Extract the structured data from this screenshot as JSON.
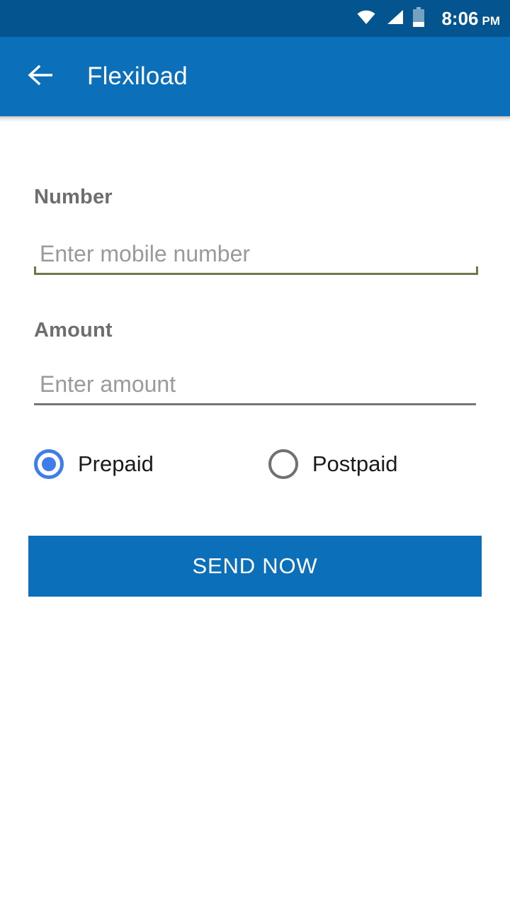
{
  "status_bar": {
    "time": "8:06",
    "ampm": "PM",
    "icons": [
      "wifi-icon",
      "cellular-signal-icon",
      "battery-icon"
    ],
    "battery_level_percent": 15,
    "background_color": "#04548f"
  },
  "app_bar": {
    "back_icon": "back-arrow-icon",
    "title": "Flexiload",
    "background_color": "#0b6fba",
    "title_color": "#ffffff"
  },
  "form": {
    "number_field": {
      "label": "Number",
      "placeholder": "Enter mobile number",
      "value": "",
      "underline_color": "#75754c",
      "focused": true
    },
    "amount_field": {
      "label": "Amount",
      "placeholder": "Enter amount",
      "value": "",
      "underline_color": "#757575",
      "focused": false
    },
    "payment_type": {
      "selected": "Prepaid",
      "options": [
        {
          "label": "Prepaid",
          "checked": true
        },
        {
          "label": "Postpaid",
          "checked": false
        }
      ],
      "selected_color": "#3f7ee8",
      "unselected_color": "#707070"
    },
    "submit_button": {
      "label": "SEND NOW",
      "background_color": "#0b6fba",
      "text_color": "#ffffff"
    }
  }
}
